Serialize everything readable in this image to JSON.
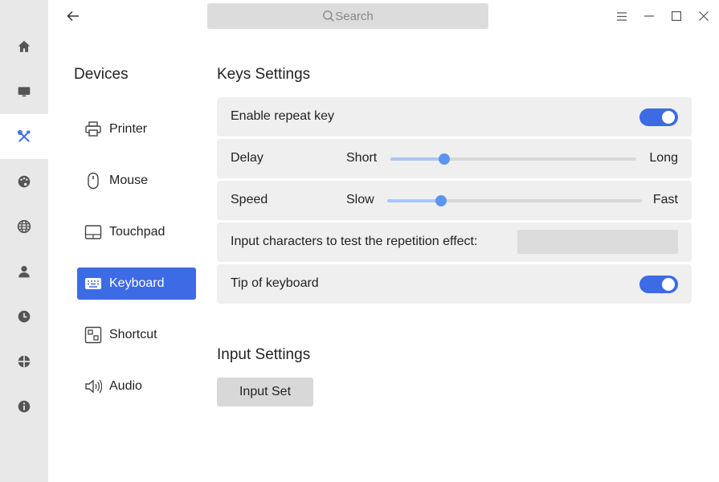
{
  "rail": {
    "items": [
      {
        "icon": "home-icon"
      },
      {
        "icon": "monitor-icon"
      },
      {
        "icon": "devices-tools-icon"
      },
      {
        "icon": "palette-icon"
      },
      {
        "icon": "globe-icon"
      },
      {
        "icon": "user-icon"
      },
      {
        "icon": "clock-icon"
      },
      {
        "icon": "update-icon"
      },
      {
        "icon": "info-icon"
      }
    ],
    "active_index": 2
  },
  "header": {
    "search_placeholder": "Search"
  },
  "devices": {
    "title": "Devices",
    "items": [
      {
        "label": "Printer",
        "icon": "printer-icon"
      },
      {
        "label": "Mouse",
        "icon": "mouse-icon"
      },
      {
        "label": "Touchpad",
        "icon": "touchpad-icon"
      },
      {
        "label": "Keyboard",
        "icon": "keyboard-icon"
      },
      {
        "label": "Shortcut",
        "icon": "shortcut-icon"
      },
      {
        "label": "Audio",
        "icon": "audio-icon"
      }
    ],
    "active_label": "Keyboard"
  },
  "keys_settings": {
    "title": "Keys Settings",
    "enable_repeat": {
      "label": "Enable repeat key",
      "on": true
    },
    "delay": {
      "label": "Delay",
      "min_label": "Short",
      "max_label": "Long",
      "value": 0.22
    },
    "speed": {
      "label": "Speed",
      "min_label": "Slow",
      "max_label": "Fast",
      "value": 0.21
    },
    "test": {
      "label": "Input characters to test the repetition effect:",
      "value": ""
    },
    "tip": {
      "label": "Tip of keyboard",
      "on": true
    }
  },
  "input_settings": {
    "title": "Input Settings",
    "button_label": "Input Set"
  },
  "colors": {
    "accent": "#3d6be5",
    "slider_knob": "#5b96ec",
    "slider_fill": "#a9c6f5",
    "rail_bg": "#e8e8e8",
    "row_bg": "#efefef"
  }
}
